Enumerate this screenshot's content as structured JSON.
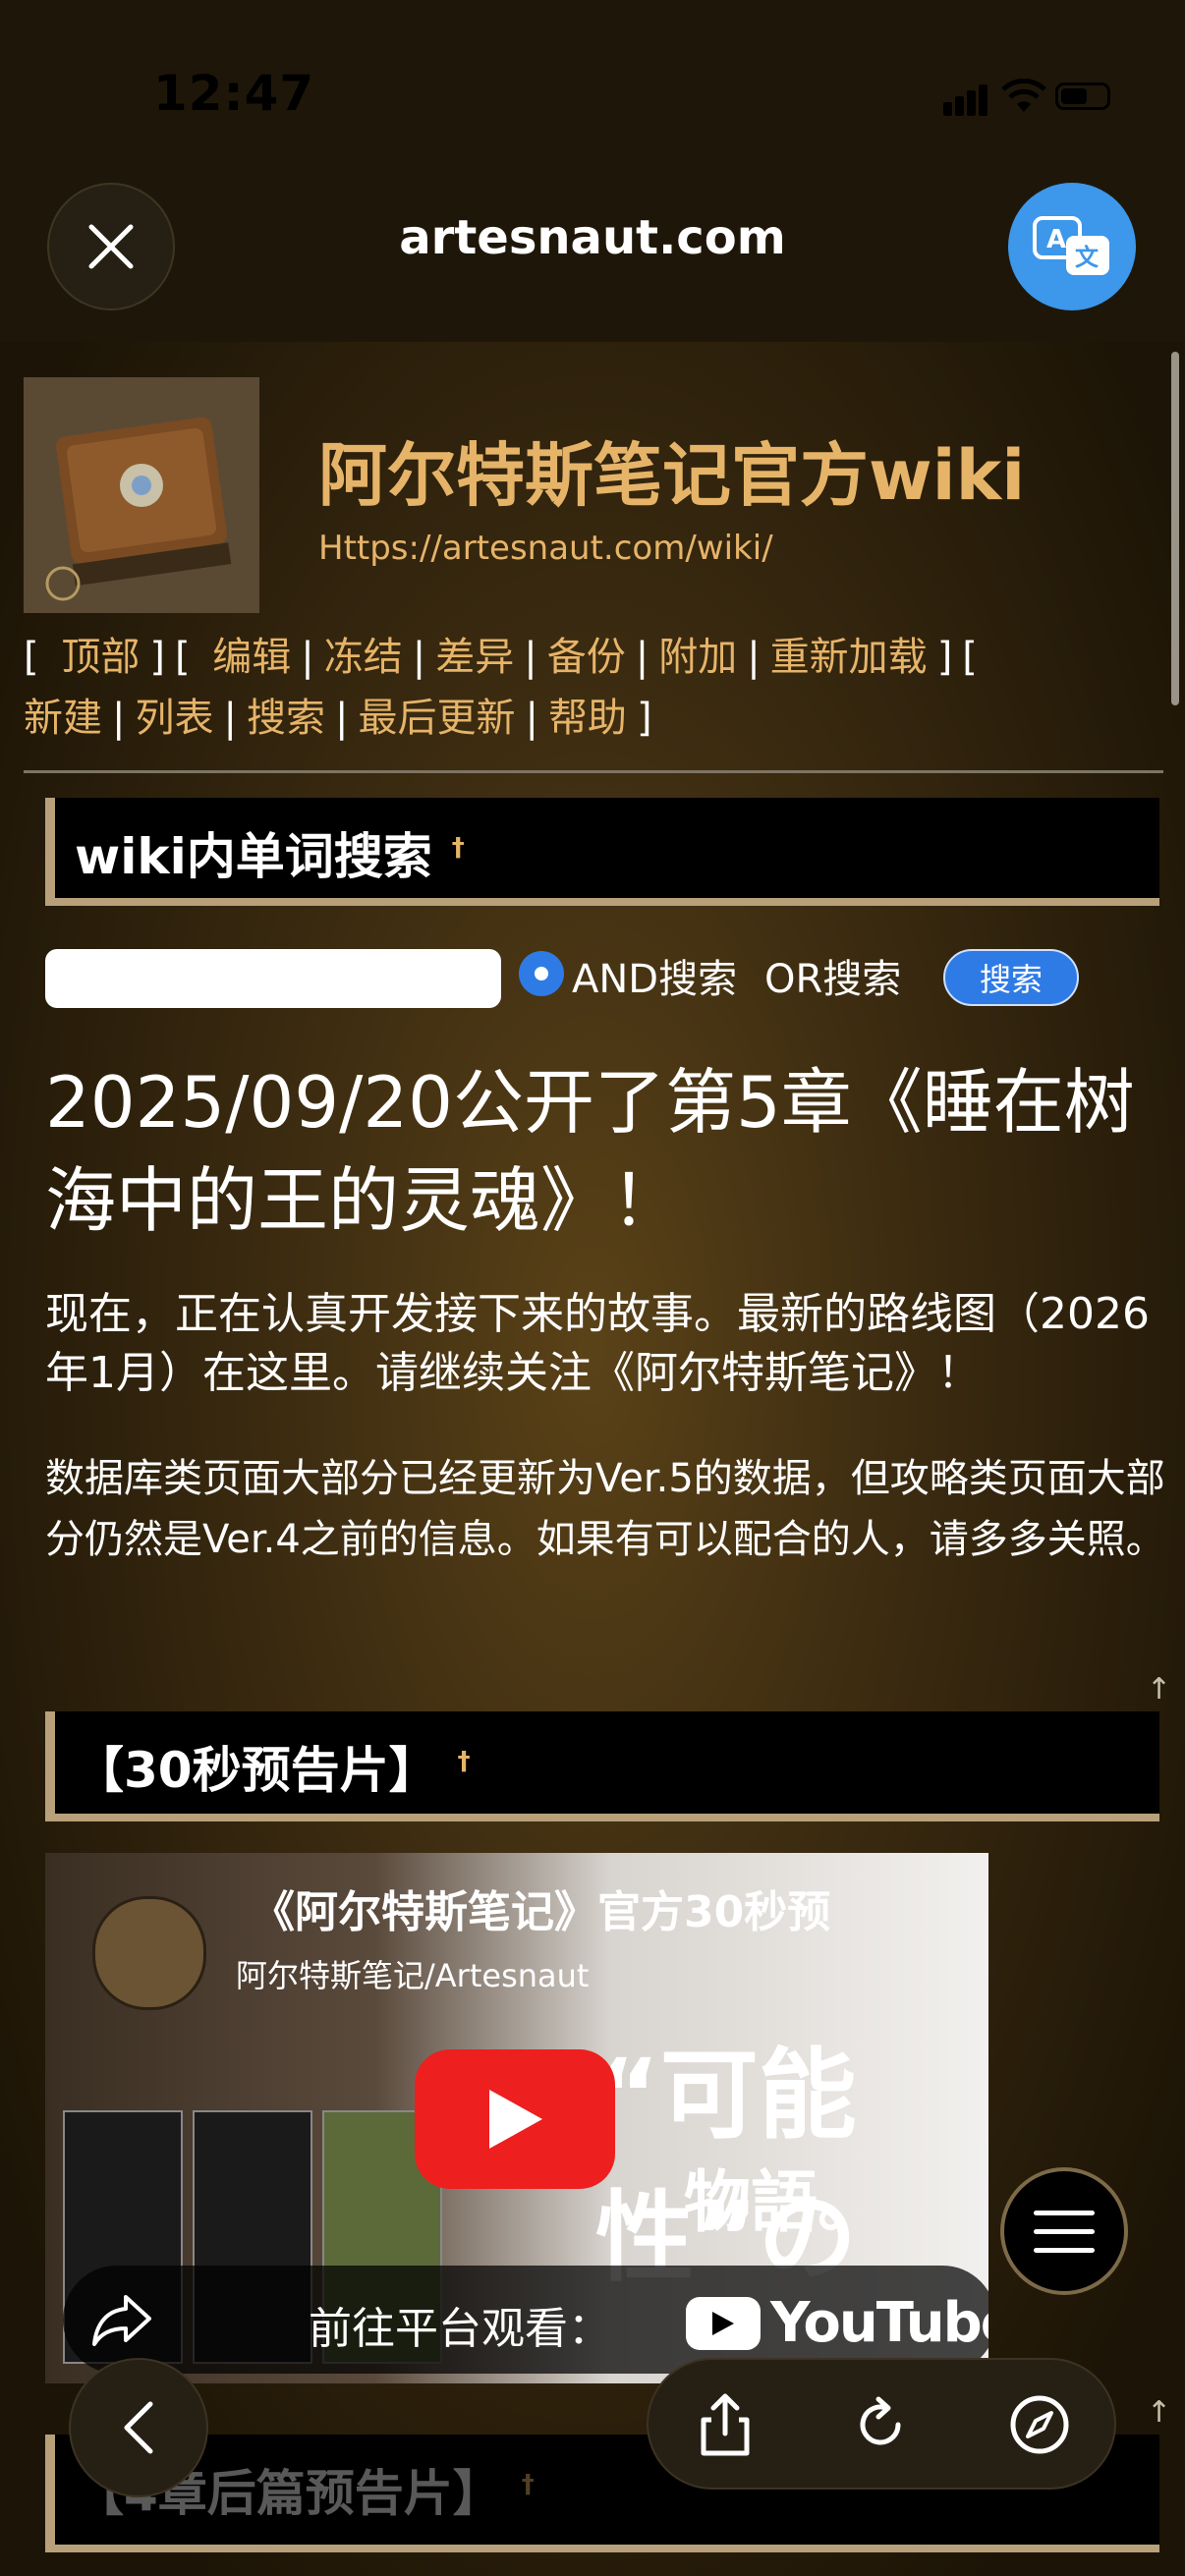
{
  "status_bar": {
    "time": "12:47",
    "icons": [
      "signal-icon",
      "wifi-icon",
      "battery-icon"
    ]
  },
  "browser": {
    "url": "artesnaut.com",
    "close_icon": "close-icon",
    "translate_icon": "translate-icon"
  },
  "site": {
    "title": "阿尔特斯笔记官方wiki",
    "url": "Https://artesnaut.com/wiki/"
  },
  "nav": {
    "items_row1": [
      "顶部",
      "编辑",
      "冻结",
      "差异",
      "备份",
      "附加",
      "重新加载"
    ],
    "items_row2": [
      "新建",
      "列表",
      "搜索",
      "最后更新",
      "帮助"
    ]
  },
  "search_section": {
    "title": "wiki内单词搜索",
    "dagger": "†",
    "input_value": "",
    "and_label": "AND搜索",
    "or_label": "OR搜索",
    "button_label": "搜索"
  },
  "main": {
    "headline": "2025/09/20公开了第5章《睡在树海中的王的灵魂》！",
    "para1": "现在，正在认真开发接下来的故事。最新的路线图（2026年1月）在这里。请继续关注《阿尔特斯笔记》！",
    "para2": "数据库类页面大部分已经更新为Ver.5的数据，但攻略类页面大部分仍然是Ver.4之前的信息。如果有可以配合的人，请多多关照。",
    "up_arrow": "↑"
  },
  "trailer_section": {
    "title": "【30秒预告片】",
    "dagger": "†"
  },
  "video": {
    "title": "《阿尔特斯笔记》官方30秒预",
    "channel": "阿尔特斯笔记/Artesnaut",
    "overlay_big": "“可能性”の",
    "overlay_big2": "物語。",
    "watch_on": "前往平台观看：",
    "platform": "YouTube"
  },
  "next_section": {
    "title": "【4章后篇预告片】",
    "dagger": "†"
  },
  "colors": {
    "accent_gold": "#e6b469",
    "link_blue": "#2f7be6",
    "translate_blue": "#3d97ea",
    "yt_red": "#ee1f1f"
  }
}
